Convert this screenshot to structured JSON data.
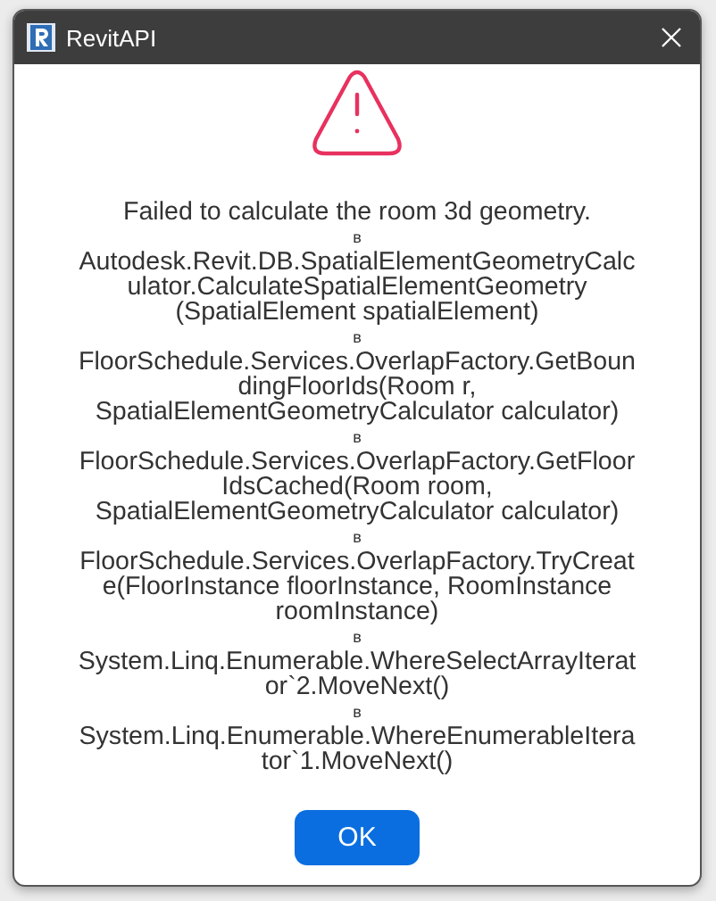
{
  "window": {
    "title": "RevitAPI"
  },
  "message": "Failed to calculate the room 3d geometry.",
  "frames": [
    {
      "prefix": "в",
      "lines": [
        "Autodesk.Revit.DB.SpatialElementGeometryCalc",
        "ulator.CalculateSpatialElementGeometry",
        "(SpatialElement spatialElement)"
      ]
    },
    {
      "prefix": "в",
      "lines": [
        "FloorSchedule.Services.OverlapFactory.GetBoun",
        "dingFloorIds(Room r,",
        "SpatialElementGeometryCalculator calculator)"
      ]
    },
    {
      "prefix": "в",
      "lines": [
        "FloorSchedule.Services.OverlapFactory.GetFloor",
        "IdsCached(Room room,",
        "SpatialElementGeometryCalculator calculator)"
      ]
    },
    {
      "prefix": "в",
      "lines": [
        "FloorSchedule.Services.OverlapFactory.TryCreat",
        "e(FloorInstance floorInstance, RoomInstance",
        "roomInstance)"
      ]
    },
    {
      "prefix": "в",
      "lines": [
        "System.Linq.Enumerable.WhereSelectArrayIterat",
        "or`2.MoveNext()"
      ]
    },
    {
      "prefix": "в",
      "lines": [
        "System.Linq.Enumerable.WhereEnumerableItera",
        "tor`1.MoveNext()"
      ]
    }
  ],
  "buttons": [
    "OK"
  ]
}
